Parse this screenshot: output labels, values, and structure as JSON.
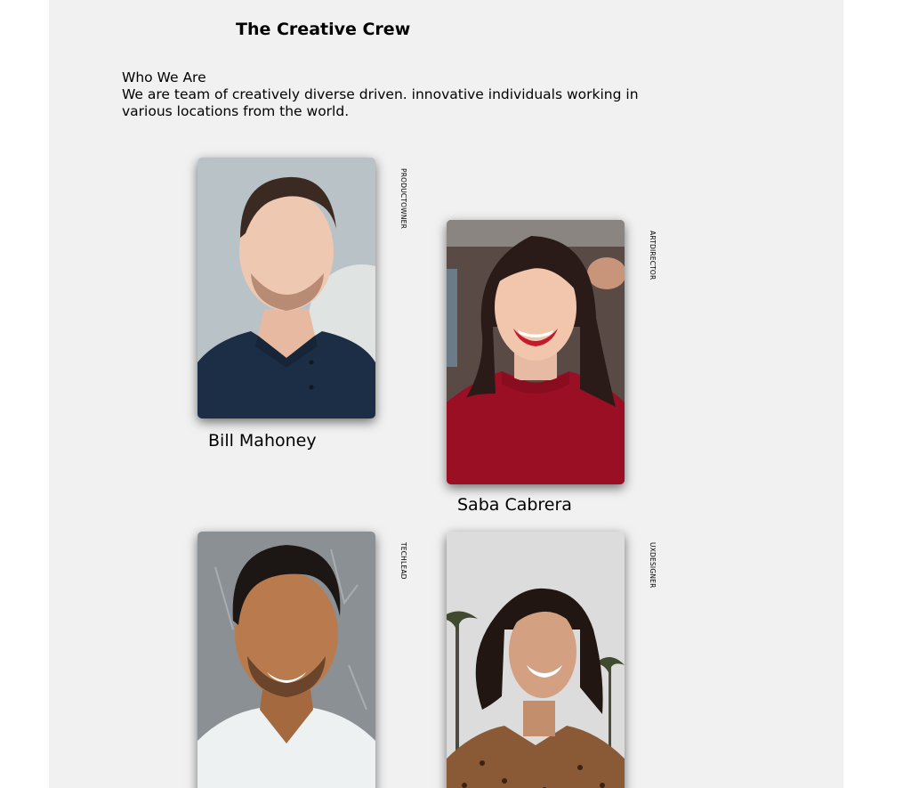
{
  "page": {
    "title": "The Creative Crew"
  },
  "intro": {
    "heading": "Who We Are",
    "body": "We are team of creatively diverse driven. innovative individuals working in various locations from the world."
  },
  "team": [
    {
      "name": "Bill Mahoney",
      "role": "PRODUCTOWNER"
    },
    {
      "name": "Saba Cabrera",
      "role": "ARTDIRECTOR"
    },
    {
      "name": "",
      "role": "TECHLEAD"
    },
    {
      "name": "",
      "role": "UXDESIGNER"
    }
  ]
}
